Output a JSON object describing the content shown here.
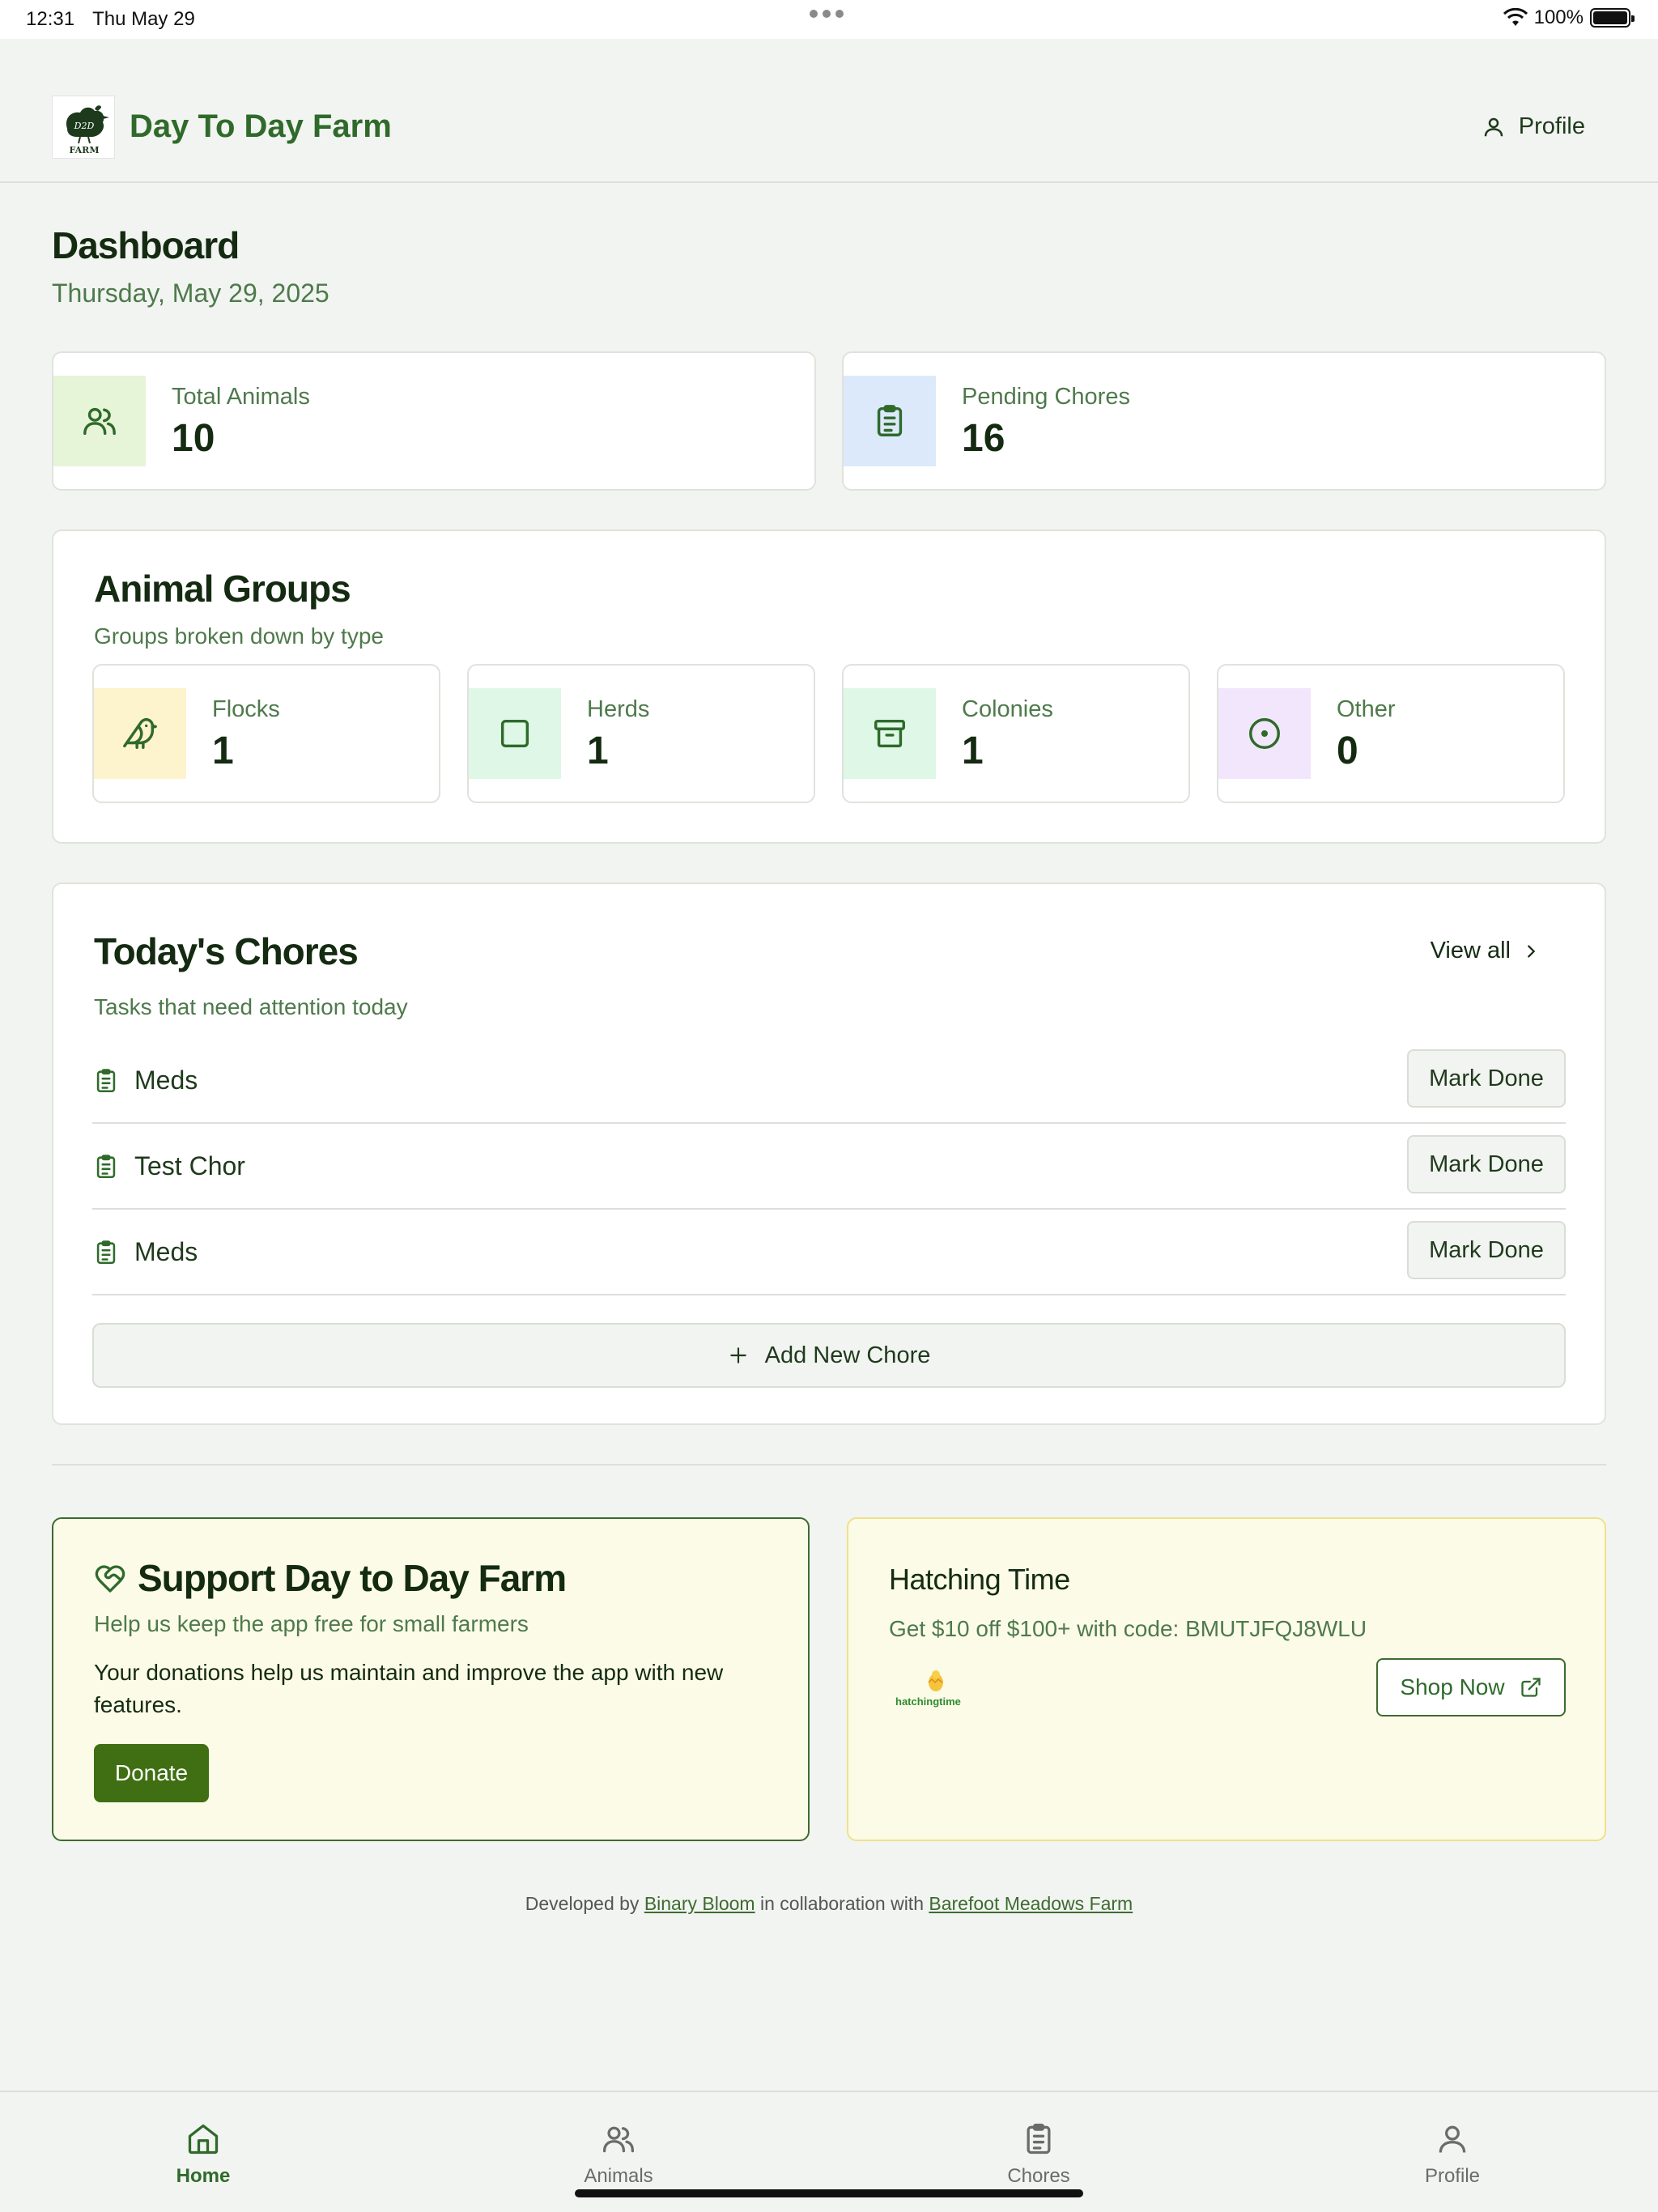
{
  "status_bar": {
    "time": "12:31",
    "date": "Thu May 29",
    "battery": "100%"
  },
  "header": {
    "app_title": "Day To Day Farm",
    "profile_label": "Profile",
    "logo_text": "FARM",
    "logo_monogram": "D2D"
  },
  "dashboard": {
    "title": "Dashboard",
    "date": "Thursday, May 29, 2025"
  },
  "stats": [
    {
      "label": "Total Animals",
      "value": "10",
      "icon": "users-icon",
      "bg": "#e6f4d8"
    },
    {
      "label": "Pending Chores",
      "value": "16",
      "icon": "clipboard-icon",
      "bg": "#dce9fb"
    }
  ],
  "animal_groups": {
    "title": "Animal Groups",
    "subtitle": "Groups broken down by type",
    "items": [
      {
        "label": "Flocks",
        "value": "1",
        "icon": "bird-icon",
        "bg": "#fdf3cc"
      },
      {
        "label": "Herds",
        "value": "1",
        "icon": "square-icon",
        "bg": "#dff7e6"
      },
      {
        "label": "Colonies",
        "value": "1",
        "icon": "archive-icon",
        "bg": "#dff7e6"
      },
      {
        "label": "Other",
        "value": "0",
        "icon": "circle-dot-icon",
        "bg": "#f1e6fb"
      }
    ]
  },
  "chores": {
    "title": "Today's Chores",
    "subtitle": "Tasks that need attention today",
    "view_all": "View all",
    "mark_done": "Mark Done",
    "add_new": "Add New Chore",
    "items": [
      {
        "name": "Meds"
      },
      {
        "name": "Test Chor"
      },
      {
        "name": "Meds"
      }
    ]
  },
  "support": {
    "title": "Support Day to Day Farm",
    "subtitle": "Help us keep the app free for small farmers",
    "text": "Your donations help us maintain and improve the app with new features.",
    "donate": "Donate"
  },
  "hatching": {
    "title": "Hatching Time",
    "subtitle": "Get $10 off $100+ with code: BMUTJFQJ8WLU",
    "logo_text": "hatchingtime",
    "shop_now": "Shop Now"
  },
  "footer": {
    "prefix": "Developed by",
    "dev_link": "Binary Bloom",
    "middle": "in collaboration with",
    "farm_link": "Barefoot Meadows Farm"
  },
  "tabs": [
    {
      "label": "Home",
      "icon": "home-icon",
      "active": true
    },
    {
      "label": "Animals",
      "icon": "users-icon",
      "active": false
    },
    {
      "label": "Chores",
      "icon": "clipboard-icon",
      "active": false
    },
    {
      "label": "Profile",
      "icon": "user-icon",
      "active": false
    }
  ],
  "colors": {
    "brand": "#2f6a2b",
    "donate": "#3f6f12",
    "background": "#f2f4f1"
  }
}
